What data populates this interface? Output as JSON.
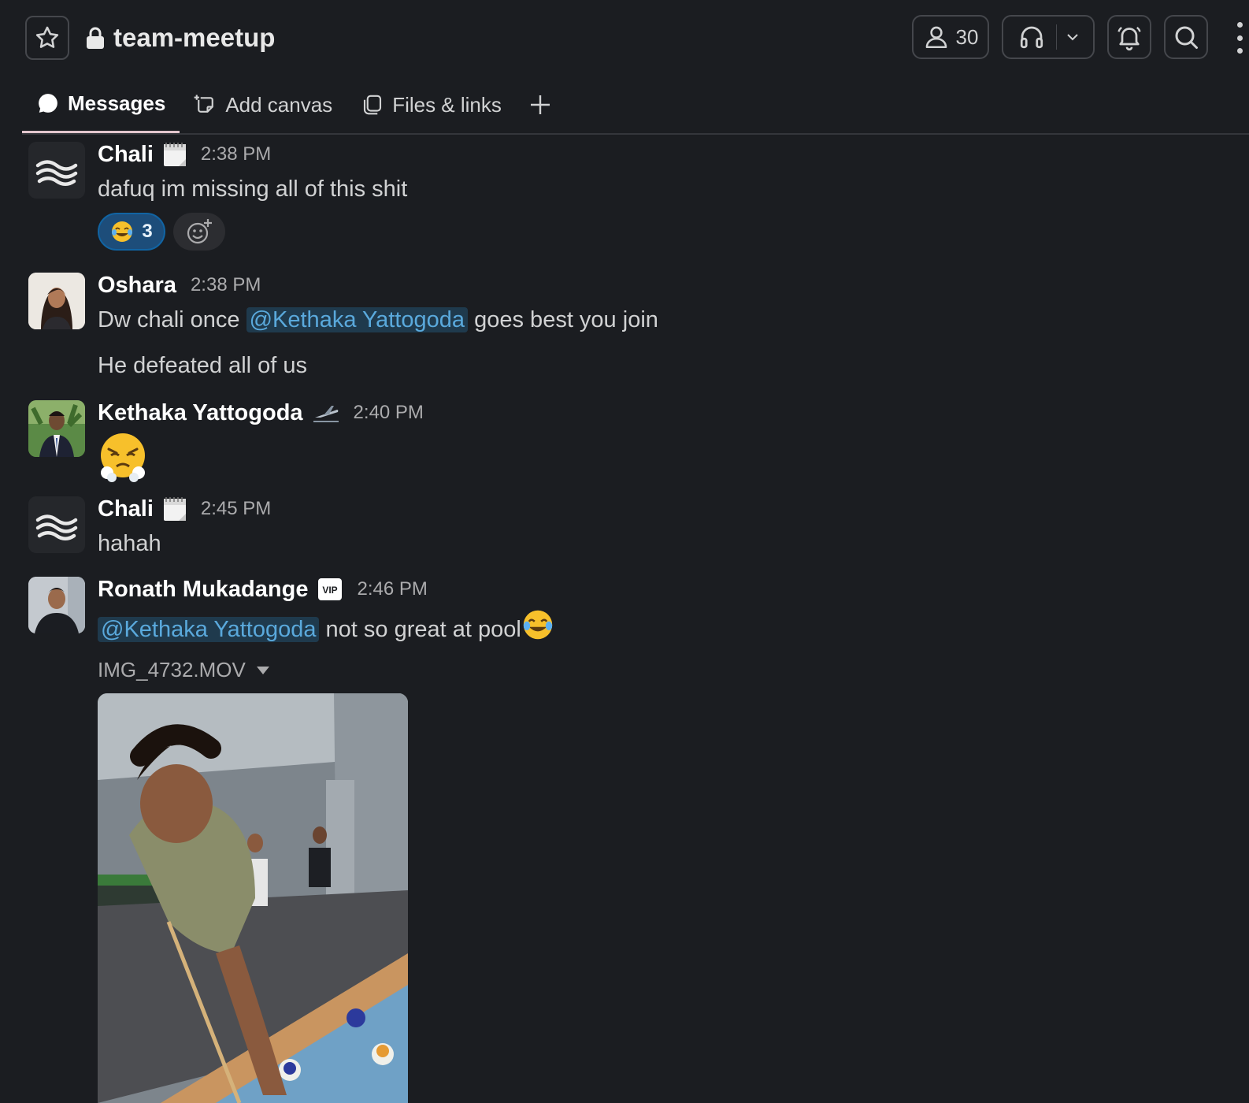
{
  "header": {
    "channel_name": "team-meetup",
    "member_count": "30"
  },
  "tabs": [
    {
      "label": "Messages",
      "active": true
    },
    {
      "label": "Add canvas",
      "active": false
    },
    {
      "label": "Files & links",
      "active": false
    }
  ],
  "messages": [
    {
      "author": "Chali",
      "time": "2:38 PM",
      "lines": [
        "dafuq im missing all of this shit"
      ],
      "reaction_count": "3"
    },
    {
      "author": "Oshara",
      "time": "2:38 PM",
      "line1_before": "Dw chali once ",
      "line1_mention": "@Kethaka Yattogoda",
      "line1_after": " goes best you join",
      "line2": "He defeated all of us"
    },
    {
      "author": "Kethaka Yattogoda",
      "time": "2:40 PM"
    },
    {
      "author": "Chali",
      "time": "2:45 PM",
      "lines": [
        "hahah"
      ]
    },
    {
      "author": "Ronath Mukadange",
      "time": "2:46 PM",
      "mention": "@Kethaka Yattogoda",
      "after": " not so great at pool",
      "file_name": "IMG_4732.MOV",
      "badge": "VIP"
    }
  ]
}
